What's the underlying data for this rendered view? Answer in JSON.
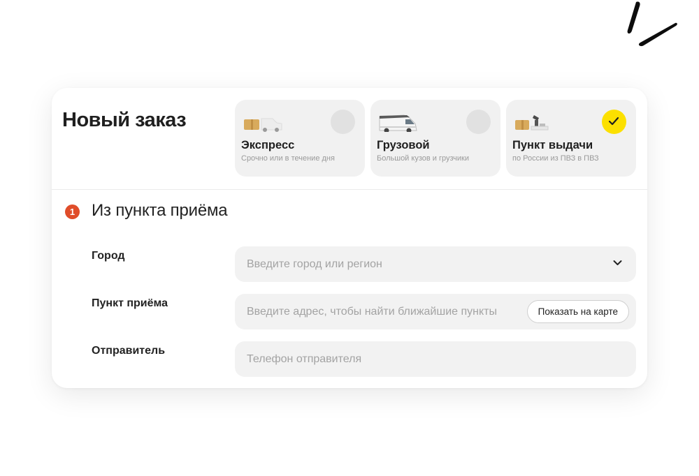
{
  "header": {
    "title": "Новый заказ"
  },
  "delivery_options": [
    {
      "name": "Экспресс",
      "description": "Срочно или в течение дня",
      "icon": "express-car-icon",
      "selected": false
    },
    {
      "name": "Грузовой",
      "description": "Большой кузов и грузчики",
      "icon": "cargo-van-icon",
      "selected": false
    },
    {
      "name": "Пункт выдачи",
      "description": "по России из ПВЗ в ПВЗ",
      "icon": "pickup-point-icon",
      "selected": true
    }
  ],
  "section": {
    "step": "1",
    "title": "Из пункта приёма"
  },
  "form": {
    "city": {
      "label": "Город",
      "placeholder": "Введите город или регион",
      "value": ""
    },
    "pickup_point": {
      "label": "Пункт приёма",
      "placeholder": "Введите адрес, чтобы найти ближайшие пункты",
      "value": "",
      "map_button": "Показать на карте"
    },
    "sender": {
      "label": "Отправитель",
      "placeholder": "Телефон отправителя",
      "value": ""
    }
  },
  "colors": {
    "accent_yellow": "#fce000",
    "step_badge": "#e04d2a",
    "field_bg": "#f2f2f2",
    "card_bg": "#f1f1f1"
  }
}
